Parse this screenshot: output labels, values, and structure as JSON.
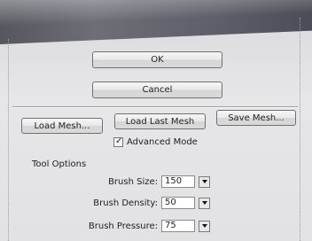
{
  "dialog": {
    "ok_label": "OK",
    "cancel_label": "Cancel",
    "load_mesh_label": "Load Mesh...",
    "load_last_mesh_label": "Load Last Mesh",
    "save_mesh_label": "Save Mesh...",
    "advanced_mode": {
      "label": "Advanced Mode",
      "checked": true
    },
    "tool_options_label": "Tool Options",
    "fields": [
      {
        "label": "Brush Size:",
        "value": "150"
      },
      {
        "label": "Brush Density:",
        "value": "50"
      },
      {
        "label": "Brush Pressure:",
        "value": "75"
      }
    ]
  },
  "colors": {
    "title_bar": "#5d5f68",
    "panel_background": "#e2e2e4"
  }
}
